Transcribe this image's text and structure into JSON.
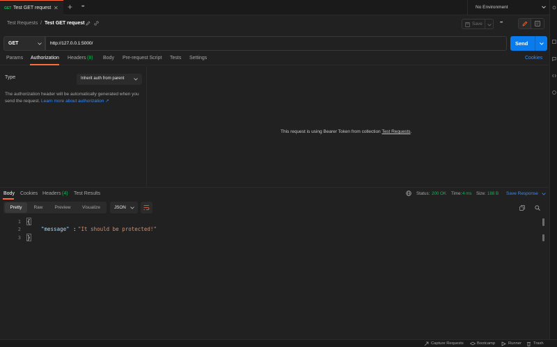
{
  "tabbar": {
    "tab_method": "GET",
    "tab_title": "Test GET request",
    "close_glyph": "✕",
    "new_tab_glyph": "+",
    "more_glyph": "•••",
    "environment": "No Environment"
  },
  "breadcrumb": {
    "collection": "Test Requests",
    "separator": "/",
    "request": "Test GET request",
    "save_label": "Save",
    "more_glyph": "•••"
  },
  "request": {
    "method": "GET",
    "url": "http://127.0.0.1:5000/",
    "send_label": "Send"
  },
  "request_tabs": {
    "params": "Params",
    "authorization": "Authorization",
    "headers": "Headers",
    "headers_count": "(8)",
    "body": "Body",
    "prerequest": "Pre-request Script",
    "tests": "Tests",
    "settings": "Settings",
    "cookies": "Cookies"
  },
  "auth": {
    "type_label": "Type",
    "type_value": "Inherit auth from parent",
    "description": "The authorization header will be automatically generated when you send the request.",
    "learn_more": "Learn more about authorization ↗",
    "bearer_note_prefix": "This request is using Bearer Token from collection",
    "bearer_note_collection": "Test Requests",
    "bearer_note_suffix": "."
  },
  "response_tabs": {
    "body": "Body",
    "cookies": "Cookies",
    "headers": "Headers",
    "headers_count": "(4)",
    "test_results": "Test Results"
  },
  "response_meta": {
    "status_label": "Status:",
    "status_value": "200 OK",
    "time_label": "Time:",
    "time_value": "4 ms",
    "size_label": "Size:",
    "size_value": "188 B",
    "save_response": "Save Response"
  },
  "response_toolbar": {
    "pretty": "Pretty",
    "raw": "Raw",
    "preview": "Preview",
    "visualize": "Visualize",
    "format": "JSON"
  },
  "response_body": {
    "line_numbers": [
      "1",
      "2",
      "3"
    ],
    "open_brace": "{",
    "key": "\"message\"",
    "colon": ":",
    "value": "\"It should be protected!\"",
    "close_brace": "}"
  },
  "statusbar": {
    "capture": "Capture Requests",
    "bootcamp": "Bootcamp",
    "runner": "Runner",
    "trash": "Trash"
  },
  "colors": {
    "accent_orange": "#ff6c37",
    "send_blue": "#097bed",
    "status_green": "#0cbb52",
    "link_blue": "#3a8cf5",
    "json_key": "#9cdcfe",
    "json_string": "#ce9178"
  }
}
